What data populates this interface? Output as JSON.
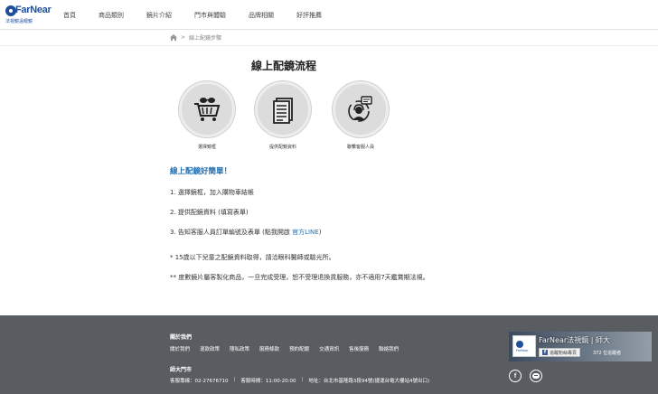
{
  "header": {
    "logo_brand": "FarNear",
    "logo_sub": "法視鏡遠眼鏡",
    "nav": [
      "首頁",
      "商品類別",
      "鏡片介紹",
      "門市與體驗",
      "品牌相關",
      "好評推薦"
    ]
  },
  "breadcrumb": {
    "current": "線上配鏡步驟",
    "separator": ">"
  },
  "title": "線上配鏡流程",
  "steps": [
    {
      "label": "選擇鏡框",
      "icon": "shopping-cart-icon"
    },
    {
      "label": "提供配鏡資料",
      "icon": "document-icon"
    },
    {
      "label": "聯繫客服人員",
      "icon": "customer-service-icon"
    }
  ],
  "content": {
    "subtitle": "線上配鏡好簡單！",
    "items": [
      "1. 選擇鏡框，加入購物車結帳",
      "2. 提供配鏡資料 (填寫表單)",
      "3. 告知客服人員訂單編號及表單 (點我開啟"
    ],
    "line_link": "官方LINE",
    "line_suffix": ")",
    "notes": [
      "* 15歲以下兒童之配鏡資料取得，請洽眼科醫師或驗光所。",
      "** 度數鏡片屬客製化商品，一旦完成受理，恕不受理退換貨服務，亦不適用7天鑑賞期法規。"
    ]
  },
  "footer": {
    "about_title": "關於我們",
    "links": [
      "關於我們",
      "退款政策",
      "隱私政策",
      "服務條款",
      "預約配鏡",
      "交通資訊",
      "售後服務",
      "聯絡我們"
    ],
    "store_title": "師大門市",
    "contact": {
      "phone": "客服專線：02-27676710",
      "hours": "客服時間：11:00-20:00",
      "address": "地址：台北市基隆路3段94號(捷運台電大樓站4號出口)"
    },
    "fb_widget": {
      "name": "FarNear法視鏡 | 師大",
      "follow": "追蹤粉絲專頁",
      "count": "372 位追蹤者"
    }
  },
  "colors": {
    "accent": "#1f6fb2",
    "footer": "#595c60",
    "logo": "#1f4f9a"
  }
}
